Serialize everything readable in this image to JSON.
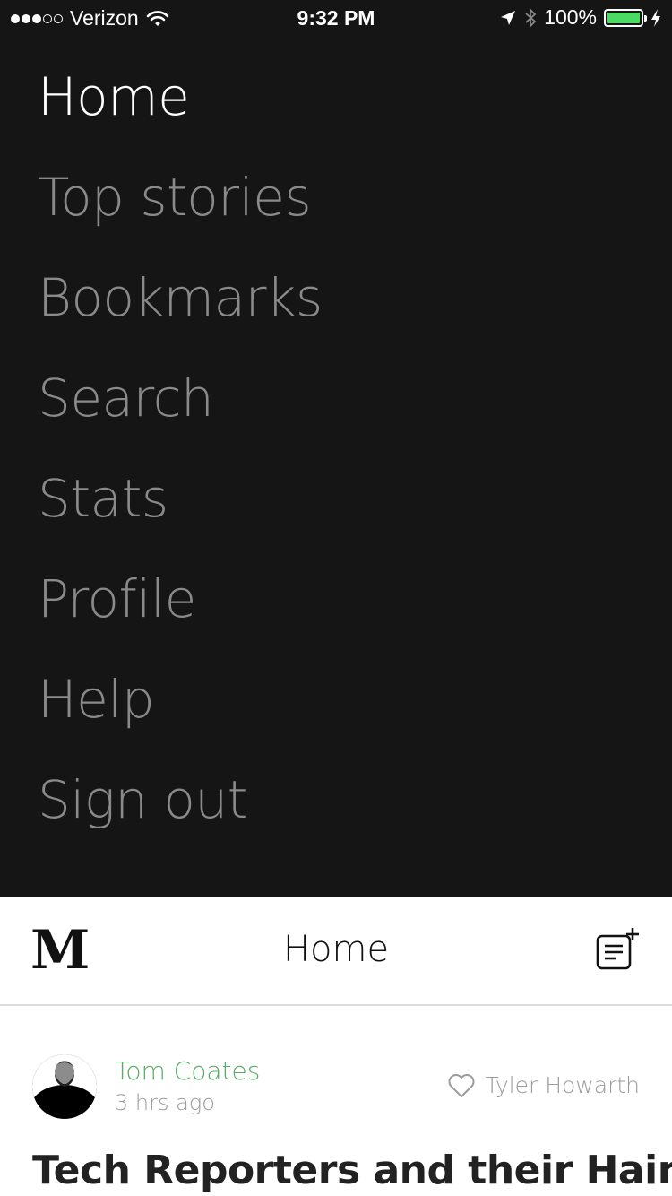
{
  "status_bar": {
    "carrier": "Verizon",
    "time": "9:32 PM",
    "battery_percent": "100%",
    "battery_level": 1.0,
    "signal_bars_filled": 3,
    "signal_bars_total": 5,
    "icons": [
      "wifi-icon",
      "location-arrow-icon",
      "bluetooth-icon",
      "charging-bolt-icon"
    ]
  },
  "menu": {
    "items": [
      {
        "label": "Home",
        "active": true
      },
      {
        "label": "Top stories",
        "active": false
      },
      {
        "label": "Bookmarks",
        "active": false
      },
      {
        "label": "Search",
        "active": false
      },
      {
        "label": "Stats",
        "active": false
      },
      {
        "label": "Profile",
        "active": false
      },
      {
        "label": "Help",
        "active": false
      },
      {
        "label": "Sign out",
        "active": false
      }
    ]
  },
  "header": {
    "logo": "M",
    "title": "Home",
    "compose_icon": "compose-icon"
  },
  "post": {
    "author": "Tom Coates",
    "time_ago": "3 hrs ago",
    "recommended_by": "Tyler Howarth",
    "title": "Tech Reporters and their Hairy"
  },
  "colors": {
    "menu_background": "#151515",
    "menu_active": "#ffffff",
    "menu_inactive": "#8a8a8a",
    "author_green": "#57ad68",
    "battery_green": "#4cd964"
  }
}
